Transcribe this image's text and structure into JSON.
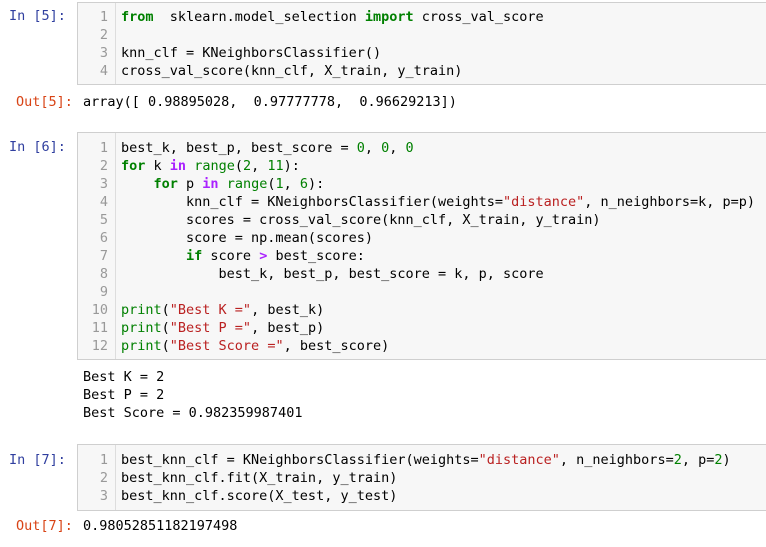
{
  "cells": [
    {
      "in_prompt": "In  [5]:",
      "lines": [
        {
          "n": "1",
          "segs": [
            [
              "kw",
              "from"
            ],
            [
              "",
              "  sklearn.model_selection "
            ],
            [
              "kw",
              "import"
            ],
            [
              "",
              " cross_val_score"
            ]
          ]
        },
        {
          "n": "2",
          "segs": []
        },
        {
          "n": "3",
          "segs": [
            [
              "",
              "knn_clf = KNeighborsClassifier()"
            ]
          ]
        },
        {
          "n": "4",
          "segs": [
            [
              "",
              "cross_val_score(knn_clf, X_train, y_train)"
            ]
          ]
        }
      ],
      "out_prompt": "Out[5]:",
      "output": "array([ 0.98895028,  0.97777778,  0.96629213])"
    },
    {
      "in_prompt": "In  [6]:",
      "lines": [
        {
          "n": "1",
          "segs": [
            [
              "",
              "best_k, best_p, best_score = "
            ],
            [
              "num",
              "0"
            ],
            [
              "",
              ", "
            ],
            [
              "num",
              "0"
            ],
            [
              "",
              ", "
            ],
            [
              "num",
              "0"
            ]
          ]
        },
        {
          "n": "2",
          "segs": [
            [
              "kw",
              "for"
            ],
            [
              "",
              " k "
            ],
            [
              "op",
              "in"
            ],
            [
              "",
              " "
            ],
            [
              "nm",
              "range"
            ],
            [
              "",
              "("
            ],
            [
              "num",
              "2"
            ],
            [
              "",
              ", "
            ],
            [
              "num",
              "11"
            ],
            [
              "",
              "):"
            ]
          ]
        },
        {
          "n": "3",
          "segs": [
            [
              "",
              "    "
            ],
            [
              "kw",
              "for"
            ],
            [
              "",
              " p "
            ],
            [
              "op",
              "in"
            ],
            [
              "",
              " "
            ],
            [
              "nm",
              "range"
            ],
            [
              "",
              "("
            ],
            [
              "num",
              "1"
            ],
            [
              "",
              ", "
            ],
            [
              "num",
              "6"
            ],
            [
              "",
              "):"
            ]
          ]
        },
        {
          "n": "4",
          "segs": [
            [
              "",
              "        knn_clf = KNeighborsClassifier(weights="
            ],
            [
              "st",
              "\"distance\""
            ],
            [
              "",
              ", n_neighbors=k, p=p)"
            ]
          ]
        },
        {
          "n": "5",
          "segs": [
            [
              "",
              "        scores = cross_val_score(knn_clf, X_train, y_train)"
            ]
          ]
        },
        {
          "n": "6",
          "segs": [
            [
              "",
              "        score = np.mean(scores)"
            ]
          ]
        },
        {
          "n": "7",
          "segs": [
            [
              "",
              "        "
            ],
            [
              "kw",
              "if"
            ],
            [
              "",
              " score "
            ],
            [
              "op",
              ">"
            ],
            [
              "",
              " best_score:"
            ]
          ]
        },
        {
          "n": "8",
          "segs": [
            [
              "",
              "            best_k, best_p, best_score = k, p, score"
            ]
          ]
        },
        {
          "n": "9",
          "segs": []
        },
        {
          "n": "10",
          "segs": [
            [
              "nm",
              "print"
            ],
            [
              "",
              "("
            ],
            [
              "st",
              "\"Best K =\""
            ],
            [
              "",
              ", best_k)"
            ]
          ]
        },
        {
          "n": "11",
          "segs": [
            [
              "nm",
              "print"
            ],
            [
              "",
              "("
            ],
            [
              "st",
              "\"Best P =\""
            ],
            [
              "",
              ", best_p)"
            ]
          ]
        },
        {
          "n": "12",
          "segs": [
            [
              "nm",
              "print"
            ],
            [
              "",
              "("
            ],
            [
              "st",
              "\"Best Score =\""
            ],
            [
              "",
              ", best_score)"
            ]
          ]
        }
      ],
      "stdout": [
        "Best K = 2",
        "Best P = 2",
        "Best Score = 0.982359987401"
      ]
    },
    {
      "in_prompt": "In  [7]:",
      "lines": [
        {
          "n": "1",
          "segs": [
            [
              "",
              "best_knn_clf = KNeighborsClassifier(weights="
            ],
            [
              "st",
              "\"distance\""
            ],
            [
              "",
              ", n_neighbors="
            ],
            [
              "num",
              "2"
            ],
            [
              "",
              ", p="
            ],
            [
              "num",
              "2"
            ],
            [
              "",
              ")"
            ]
          ]
        },
        {
          "n": "2",
          "segs": [
            [
              "",
              "best_knn_clf.fit(X_train, y_train)"
            ]
          ]
        },
        {
          "n": "3",
          "segs": [
            [
              "",
              "best_knn_clf.score(X_test, y_test)"
            ]
          ]
        }
      ],
      "out_prompt": "Out[7]:",
      "output": "0.98052851182197498"
    }
  ]
}
